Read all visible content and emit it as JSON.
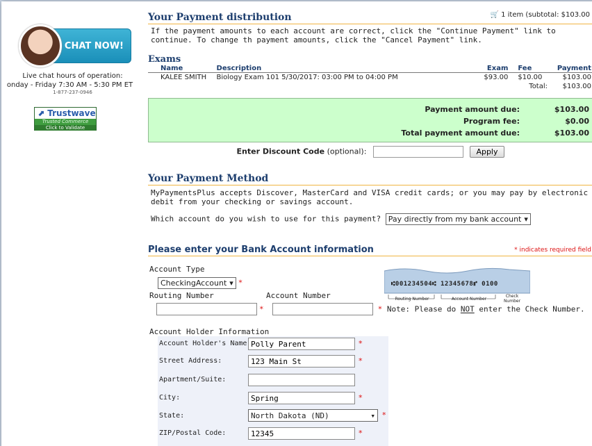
{
  "sidebar": {
    "chat_label": "CHAT NOW!",
    "hours_title": "Live chat hours of operation:",
    "hours_detail": "onday - Friday 7:30 AM - 5:30 PM ET",
    "phone": "1-877-237-0946",
    "trust_brand": "Trustwave",
    "trust_line": "Trusted Commerce",
    "trust_cta": "Click to Validate"
  },
  "cart": {
    "summary": "1 item (subtotal: $103.00"
  },
  "distribution": {
    "title": "Your Payment distribution",
    "info": "If the payment amounts to each account are correct, click the \"Continue Payment\" link to continue. To change th payment amounts, click the \"Cancel Payment\" link."
  },
  "exams": {
    "title": "Exams",
    "headers": {
      "name": "Name",
      "description": "Description",
      "exam": "Exam",
      "fee": "Fee",
      "payment": "Payment"
    },
    "rows": [
      {
        "name": "KALEE SMITH",
        "description": "Biology Exam 101 5/30/2017: 03:00 PM to 04:00 PM",
        "exam": "$93.00",
        "fee": "$10.00",
        "payment": "$103.00"
      }
    ],
    "total_label": "Total:",
    "total_value": "$103.00"
  },
  "due": {
    "amount_label": "Payment amount due:",
    "amount_value": "$103.00",
    "fee_label": "Program fee:",
    "fee_value": "$0.00",
    "total_label": "Total payment amount due:",
    "total_value": "$103.00"
  },
  "discount": {
    "label": "Enter Discount Code",
    "optional": "(optional):",
    "value": "",
    "apply_label": "Apply"
  },
  "method": {
    "title": "Your Payment Method",
    "info": "MyPaymentsPlus accepts Discover, MasterCard and VISA credit cards; or you may pay by electronic debit from your checking or savings account.",
    "question": "Which account do you wish to use for this payment?",
    "selected": "Pay directly from my bank account"
  },
  "bank": {
    "title": "Please enter your Bank Account information",
    "required_note": "* indicates required field",
    "account_type_label": "Account Type",
    "account_type_value": "CheckingAccount",
    "routing_label": "Routing Number",
    "routing_value": "",
    "account_label": "Account Number",
    "account_value": "",
    "check_note_prefix": "Note: Please do ",
    "check_note_not": "NOT",
    "check_note_suffix": " enter the Check Number.",
    "check_micr": "⑆001234504⑆ 12345678⑈ 0100",
    "check_routing_caption": "Routing Number",
    "check_account_caption": "Account Number",
    "check_number_caption": "Check Number"
  },
  "holder": {
    "title": "Account Holder Information",
    "name_label": "Account Holder's Name:",
    "name_value": "Polly Parent",
    "street_label": "Street Address:",
    "street_value": "123 Main St",
    "apt_label": "Apartment/Suite:",
    "apt_value": "",
    "city_label": "City:",
    "city_value": "Spring",
    "state_label": "State:",
    "state_value": "North Dakota (ND)",
    "zip_label": "ZIP/Postal Code:",
    "zip_value": "12345"
  },
  "colors": {
    "heading": "#1d3e6e",
    "rule": "#f0b441",
    "due_bg": "#ccffcc",
    "required": "#dd1111"
  }
}
